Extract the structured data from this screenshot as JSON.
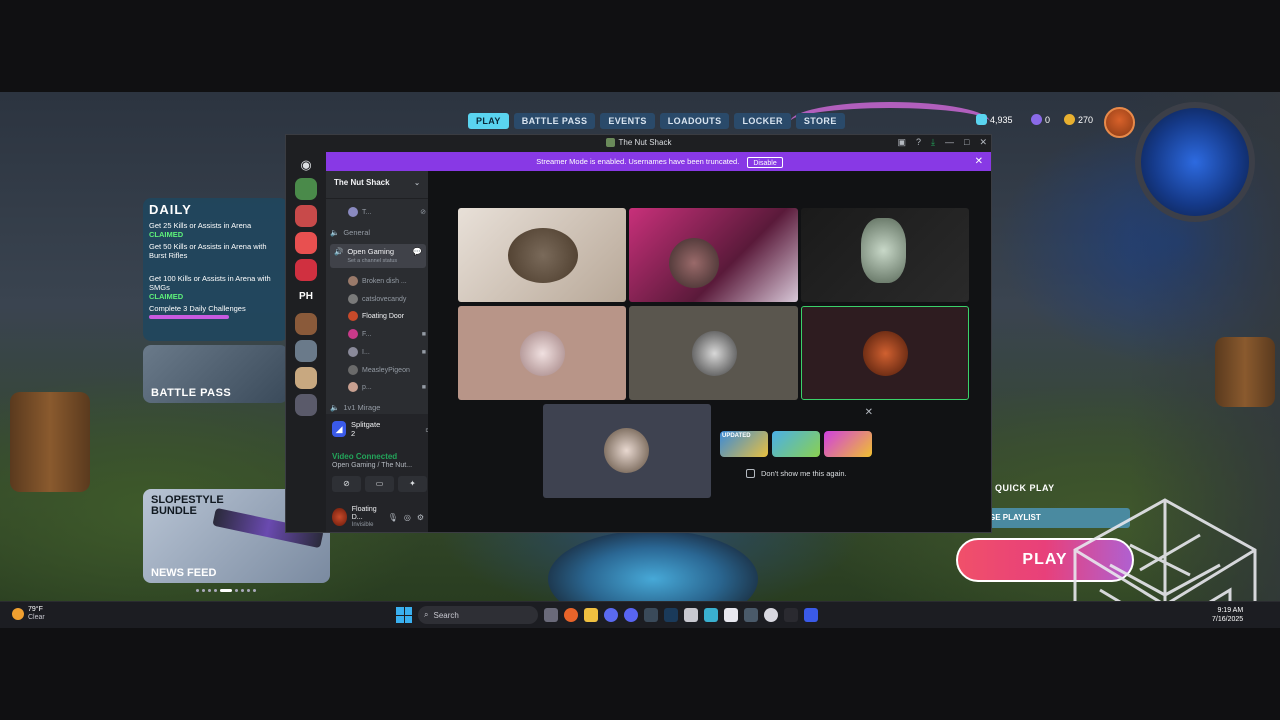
{
  "game": {
    "nav": [
      "PLAY",
      "BATTLE PASS",
      "EVENTS",
      "LOADOUTS",
      "LOCKER",
      "STORE"
    ],
    "currency": {
      "credits": "4,935",
      "premium": "0",
      "coins": "270"
    },
    "daily": {
      "title": "DAILY",
      "challenges": [
        {
          "text": "Get 25 Kills or Assists in Arena",
          "status": "CLAIMED"
        },
        {
          "text": "Get 50 Kills or Assists in Arena with Burst Rifles",
          "status": ""
        },
        {
          "text": "Get 100 Kills or Assists in Arena with SMGs",
          "status": "CLAIMED"
        },
        {
          "text": "Complete 3 Daily Challenges",
          "status": ""
        }
      ]
    },
    "battle_pass_label": "BATTLE PASS",
    "bundle": {
      "title": "SLOPESTYLE BUNDLE",
      "news": "NEWS FEED"
    },
    "quick_play": "QUICK PLAY",
    "playlist": "GE PLAYLIST",
    "play_button": "PLAY"
  },
  "discord": {
    "window_title": "The Nut Shack",
    "streamer_banner": "Streamer Mode is enabled. Usernames have been truncated.",
    "disable_label": "Disable",
    "server_ph": "PH",
    "guild_name": "The Nut Shack",
    "channels": {
      "top_user": "T...",
      "general": "General",
      "open_gaming": "Open Gaming",
      "open_gaming_status": "Set a channel status",
      "users": [
        "Broken dish ...",
        "catslovecandy",
        "Floating Door",
        "F...",
        "I...",
        "MeasleyPigeon",
        "p..."
      ],
      "next_channel": "1v1 Mirage"
    },
    "voice": {
      "game": "Splitgate 2",
      "connected": "Video Connected",
      "channel": "Open Gaming / The Nut...",
      "username": "Floating D...",
      "user_status": "Invisible"
    },
    "popup": {
      "dont_show": "Don't show me this again.",
      "thumb_label": "UPDATED"
    }
  },
  "taskbar": {
    "temperature": "79°F",
    "weather": "Clear",
    "search_placeholder": "Search",
    "time": "9:19 AM",
    "date": "7/16/2025"
  },
  "colors": {
    "discord_accent": "#8839e5",
    "connected_green": "#23a55a",
    "play_pink": "#f0506a",
    "nav_active": "#5ad4f0"
  }
}
